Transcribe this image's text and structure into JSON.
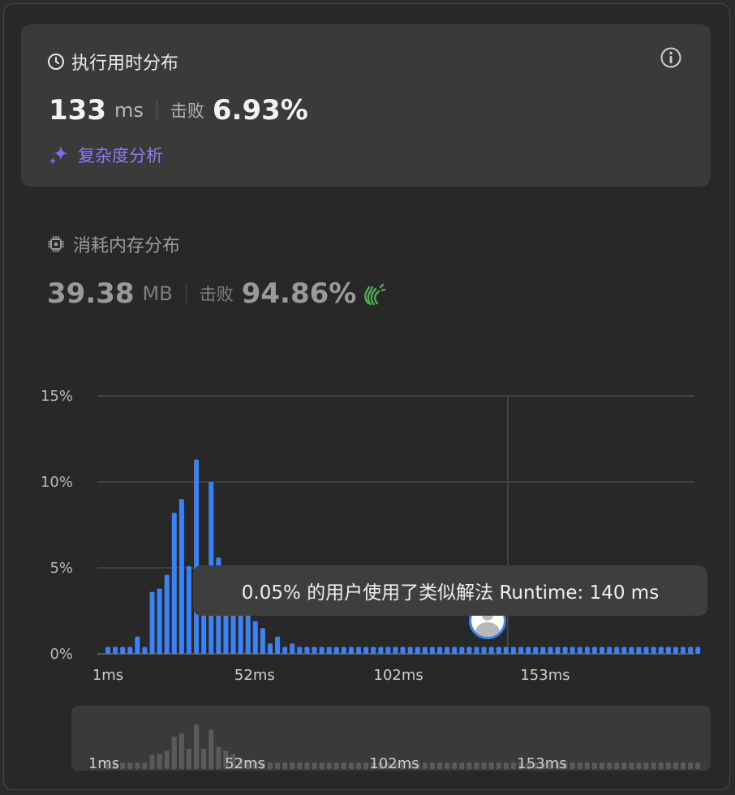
{
  "runtime": {
    "title": "执行用时分布",
    "value": "133",
    "unit": "ms",
    "beat_label": "击败",
    "beat_value": "6.93%",
    "complexity_link": "复杂度分析",
    "info_icon": "info-icon",
    "clock_icon": "clock-icon",
    "sparkle_icon": "sparkle-icon"
  },
  "memory": {
    "title": "消耗内存分布",
    "value": "39.38",
    "unit": "MB",
    "beat_label": "击败",
    "beat_value": "94.86%",
    "chip_icon": "chip-icon",
    "clap_icon": "clap-icon"
  },
  "tooltip": {
    "text": "0.05% 的用户使用了类似解法 Runtime: 140 ms"
  },
  "colors": {
    "bar": "#3b82f6",
    "overview_bar": "#5a5a5a",
    "link": "#8c7cf5",
    "clap": "#4caf50"
  },
  "chart_data": {
    "type": "bar",
    "xlabel": "",
    "ylabel": "",
    "y_ticks": [
      "0%",
      "5%",
      "10%",
      "15%"
    ],
    "ylim": [
      0,
      15
    ],
    "x_tick_labels": [
      "1ms",
      "52ms",
      "102ms",
      "153ms"
    ],
    "x_tick_values": [
      1,
      52,
      102,
      153
    ],
    "bin_width_ms": 2.5,
    "grid": true,
    "crosshair_x_ms": 140,
    "highlight_runtime_ms": 140,
    "highlight_percent": 0.05,
    "values": [
      0.4,
      0.4,
      0.4,
      0.4,
      1.0,
      0.4,
      3.6,
      3.8,
      4.6,
      8.2,
      9.0,
      5.1,
      11.3,
      5.1,
      10.0,
      5.6,
      4.6,
      3.8,
      2.6,
      2.3,
      1.9,
      1.5,
      0.6,
      1.0,
      0.4,
      0.6,
      0.4,
      0.4,
      0.4,
      0.4,
      0.4,
      0.4,
      0.4,
      0.4,
      0.4,
      0.4,
      0.4,
      0.4,
      0.4,
      0.4,
      0.4,
      0.4,
      0.4,
      0.4,
      0.4,
      0.4,
      0.4,
      0.4,
      0.4,
      0.4,
      0.4,
      0.4,
      0.4,
      0.4,
      0.4,
      0.4,
      0.4,
      0.4,
      0.4,
      0.4,
      0.4,
      0.4,
      0.4,
      0.4,
      0.4,
      0.4,
      0.4,
      0.4,
      0.4,
      0.4,
      0.4,
      0.4,
      0.4,
      0.4,
      0.4,
      0.4,
      0.4,
      0.4,
      0.4,
      0.4,
      0.4
    ]
  }
}
